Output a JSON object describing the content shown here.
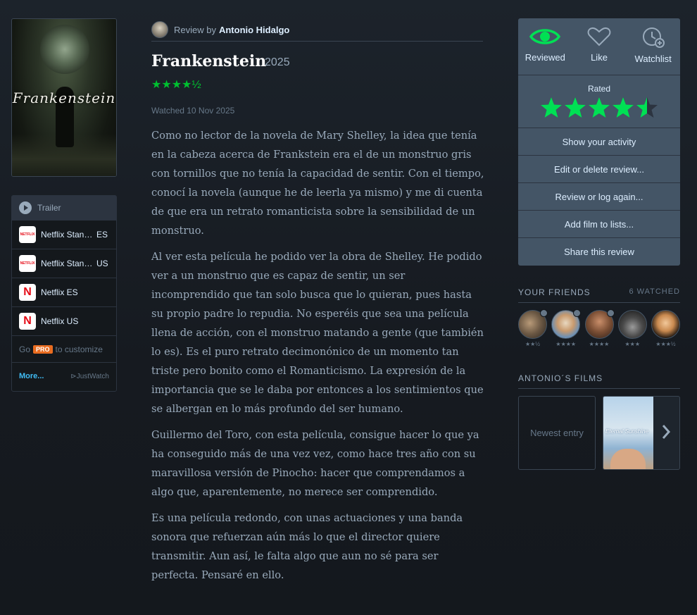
{
  "poster": {
    "title_art": "Frankenstein"
  },
  "watch": {
    "trailer_label": "Trailer",
    "services": [
      {
        "logo_text": "NETFLIX",
        "name": "Netflix Stan…",
        "region": "ES"
      },
      {
        "logo_text": "NETFLIX",
        "name": "Netflix Stan…",
        "region": "US"
      },
      {
        "logo_text": "N",
        "name": "Netflix ES",
        "region": ""
      },
      {
        "logo_text": "N",
        "name": "Netflix US",
        "region": ""
      }
    ],
    "go": "Go",
    "pro": "PRO",
    "customize": "to customize",
    "more": "More...",
    "justwatch": "JustWatch"
  },
  "review": {
    "prefix": "Review by",
    "author": "Antonio Hidalgo",
    "film_title": "Frankenstein",
    "year": "2025",
    "stars": "★★★★½",
    "rating": 4.5,
    "watched": "Watched 10 Nov 2025",
    "paragraphs": [
      "Como no lector de la novela de Mary Shelley, la idea que tenía en la cabeza acerca de Frankstein era el de un monstruo gris con tornillos que no tenía la capacidad de sentir. Con el tiempo, conocí la novela (aunque he de leerla ya mismo) y me di cuenta de que era un retrato romanticista sobre la sensibilidad de un monstruo.",
      "Al ver esta película he podido ver la obra de Shelley. He podido ver a un monstruo que es capaz de sentir, un ser incomprendido que tan solo busca que lo quieran, pues hasta su propio padre lo repudia. No esperéis que sea una película llena de acción, con el monstruo matando a gente (que también lo es). Es el puro retrato decimonónico de un momento tan triste pero bonito como el Romanticismo. La expresión de la importancia que se le daba por entonces a los sentimientos que se albergan en lo más profundo del ser humano.",
      "Guillermo del Toro, con esta película, consigue hacer lo que ya ha conseguido más de una vez vez, como hace tres año con su maravillosa versión de Pinocho: hacer que comprendamos a algo que, aparentemente, no merece ser comprendido.",
      "Es una película redondo, con unas actuaciones y una banda sonora que refuerzan aún más lo que el director quiere transmitir. Aun así, le falta algo que aun no sé para ser perfecta. Pensaré en ello."
    ]
  },
  "actions": {
    "reviewed": "Reviewed",
    "like": "Like",
    "watchlist": "Watchlist",
    "rated": "Rated",
    "menu": [
      "Show your activity",
      "Edit or delete review...",
      "Review or log again...",
      "Add film to lists...",
      "Share this review"
    ],
    "accent_color": "#00e054"
  },
  "friends": {
    "heading": "YOUR FRIENDS",
    "count": "6 WATCHED",
    "ratings": [
      "★★½",
      "★★★★",
      "★★★★",
      "★★★",
      "★★★½"
    ]
  },
  "films": {
    "heading": "ANTONIO´S FILMS",
    "newest": "Newest entry",
    "poster_title": "Eternal Sunshine"
  }
}
